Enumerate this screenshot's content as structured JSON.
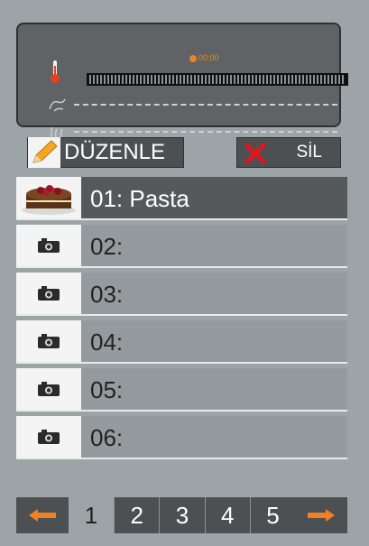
{
  "display": {
    "timer_text": "00:00",
    "temperature_bar": "temperature-bar",
    "humidity_dashes": "",
    "steam_dashes": ""
  },
  "buttons": {
    "edit_label": "DÜZENLE",
    "delete_label": "SİL"
  },
  "recipes": [
    {
      "label": "01: Pasta",
      "selected": true,
      "thumb": "cake"
    },
    {
      "label": "02:",
      "selected": false,
      "thumb": "camera-icon"
    },
    {
      "label": "03:",
      "selected": false,
      "thumb": "camera-icon"
    },
    {
      "label": "04:",
      "selected": false,
      "thumb": "camera-icon"
    },
    {
      "label": "05:",
      "selected": false,
      "thumb": "camera-icon"
    },
    {
      "label": "06:",
      "selected": false,
      "thumb": "camera-icon"
    }
  ],
  "pagination": {
    "pages": [
      "1",
      "2",
      "3",
      "4",
      "5"
    ],
    "current": "1"
  },
  "colors": {
    "accent": "#f08020",
    "background": "#9da4a8",
    "selected_row": "#56595b"
  }
}
